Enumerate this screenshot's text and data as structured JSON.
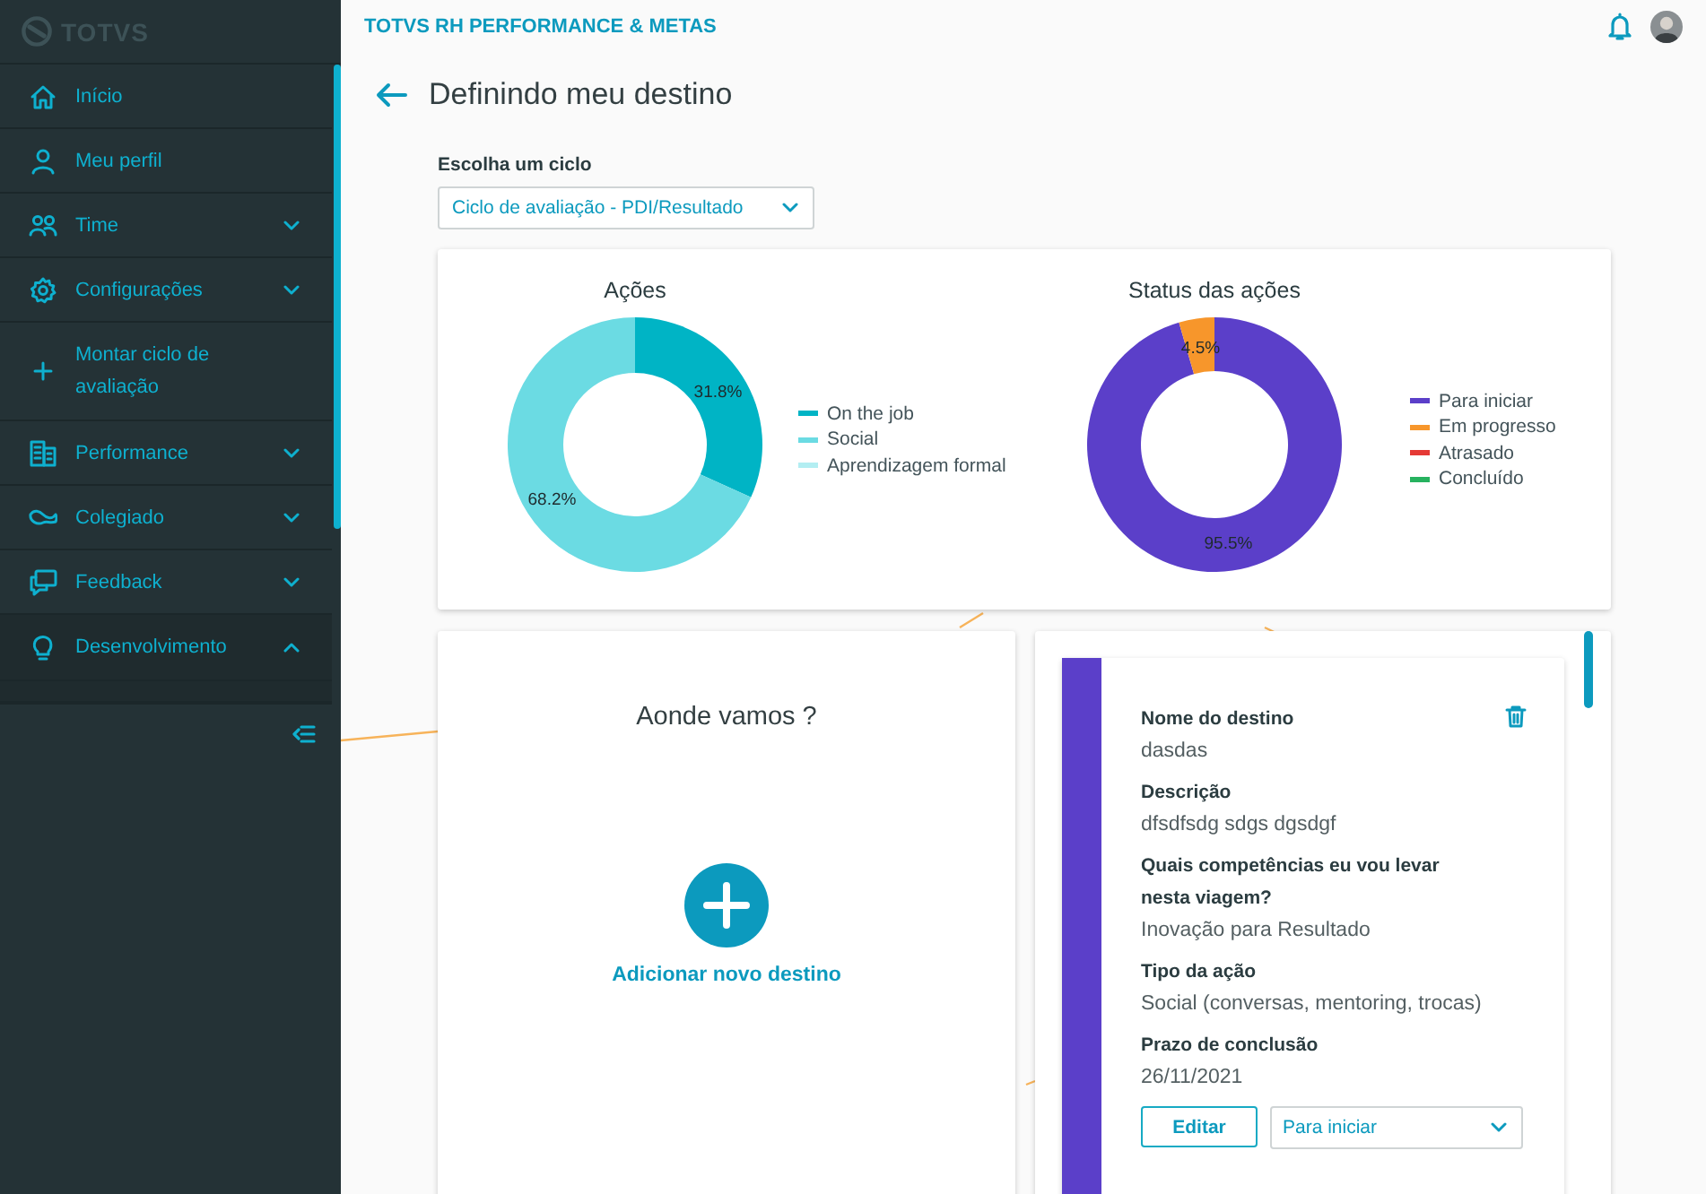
{
  "sidebar": {
    "logo": "TOTVS",
    "items": [
      {
        "label": "Início",
        "kind": "link",
        "selected": false
      },
      {
        "label": "Meu perfil",
        "kind": "link",
        "selected": false
      },
      {
        "label": "Time",
        "kind": "group",
        "expanded": false,
        "selected": false
      },
      {
        "label": "Configurações",
        "kind": "group",
        "expanded": false,
        "selected": false
      },
      {
        "label": "Montar ciclo de avaliação",
        "kind": "link",
        "selected": false
      },
      {
        "label": "Performance",
        "kind": "group",
        "expanded": false,
        "selected": false
      },
      {
        "label": "Colegiado",
        "kind": "group",
        "expanded": false,
        "selected": false
      },
      {
        "label": "Feedback",
        "kind": "group",
        "expanded": false,
        "selected": false
      },
      {
        "label": "Desenvolvimento",
        "kind": "group",
        "expanded": true,
        "selected": true
      }
    ]
  },
  "header": {
    "title": "TOTVS RH PERFORMANCE & METAS"
  },
  "page": {
    "title": "Definindo meu destino",
    "cycle_select": {
      "label": "Escolha um ciclo",
      "value": "Ciclo de avaliação - PDI/Resultado"
    }
  },
  "charts": [
    {
      "chart_data": {
        "type": "donut",
        "title": "Ações",
        "categories": [
          "On the job",
          "Social",
          "Aprendizagem formal"
        ],
        "series": [
          {
            "colors": [
              "#00b4c5",
              "#6bdbe3",
              "#b3eef2"
            ],
            "values": [
              31.8,
              68.2,
              0
            ]
          }
        ],
        "data_labels": "value_labels",
        "value_labels": [
          "31.8%",
          "68.2%",
          null
        ]
      }
    },
    {
      "chart_data": {
        "type": "donut",
        "title": "Status das ações",
        "categories": [
          "Para iniciar",
          "Em progresso",
          "Atrasado",
          "Concluído"
        ],
        "series": [
          {
            "colors": [
              "#5b3fc9",
              "#f7962b",
              "#e53935",
              "#27b25f"
            ],
            "values": [
              95.5,
              4.5,
              0,
              0
            ]
          }
        ],
        "data_labels": "value_labels",
        "value_labels": [
          "95.5%",
          "4.5%",
          null,
          null
        ]
      }
    }
  ],
  "add_card": {
    "title": "Aonde vamos ?",
    "action": "Adicionar novo destino"
  },
  "goal_card": {
    "fields": [
      {
        "label": "Nome do destino",
        "value": "dasdas"
      },
      {
        "label": "Descrição",
        "value": "dfsdfsdg sdgs dgsdgf"
      },
      {
        "label": "Quais competências eu vou levar nesta viagem?",
        "value": "Inovação para Resultado"
      },
      {
        "label": "Tipo da ação",
        "value": "Social (conversas, mentoring, trocas)"
      },
      {
        "label": "Prazo de conclusão",
        "value": "26/11/2021"
      }
    ],
    "edit_button": "Editar",
    "status_select": "Para iniciar"
  }
}
